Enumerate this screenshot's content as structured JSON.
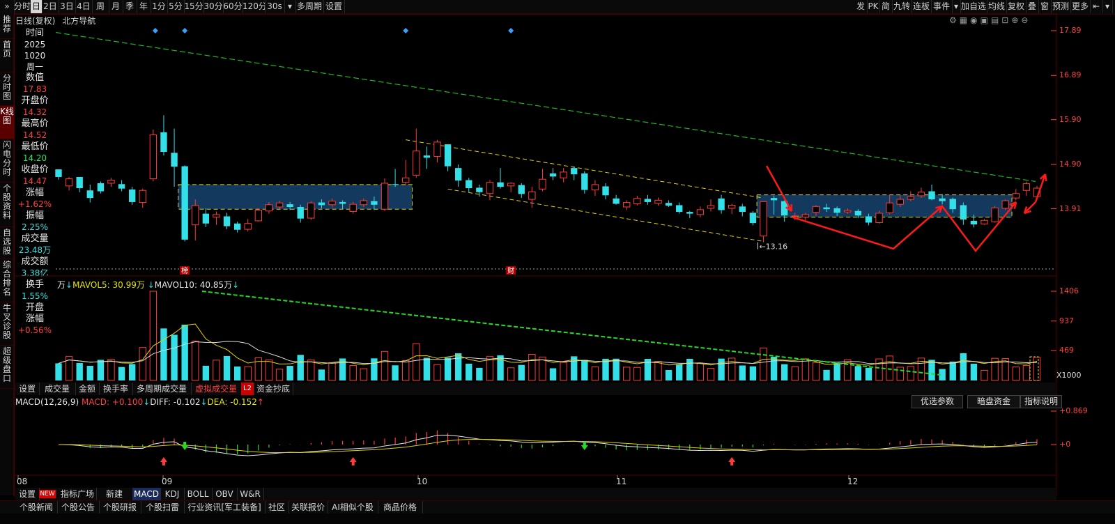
{
  "topbar": {
    "left_items": [
      "»",
      "分时",
      "日",
      "2日",
      "3日",
      "4日",
      "周",
      "月",
      "季",
      "年",
      "1分",
      "5分",
      "15分",
      "30分",
      "60分",
      "120分",
      "30s",
      "▾",
      "多周期",
      "设置"
    ],
    "right_items": [
      "发",
      "PK",
      "简",
      "九转",
      "连板",
      "事件",
      "▾",
      "加自选",
      "均线",
      "复权",
      "叠",
      "窗",
      "预测",
      "更多",
      "⇤",
      "▾"
    ]
  },
  "leftnav": [
    "推荐",
    "首页",
    "分时图",
    "K线图",
    "闪电分时",
    "个股资料",
    "自选股",
    "综合排名",
    "牛叉诊股",
    "超级盘口"
  ],
  "chart_header": {
    "title": "日线(复权)",
    "stock": "北方导航"
  },
  "info_panel": [
    {
      "label": "时间",
      "value_lines": [
        "2025",
        "1020",
        "周一"
      ],
      "color": "lbl"
    },
    {
      "label": "数值",
      "value": "17.83",
      "color": "red"
    },
    {
      "label": "开盘价",
      "value": "14.32",
      "color": "red"
    },
    {
      "label": "最高价",
      "value": "14.52",
      "color": "red"
    },
    {
      "label": "最低价",
      "value": "14.20",
      "color": "grn"
    },
    {
      "label": "收盘价",
      "value": "14.47",
      "color": "red"
    },
    {
      "label": "涨幅",
      "value": "+1.62%",
      "color": "red"
    },
    {
      "label": "振幅",
      "value": "2.25%",
      "color": "cyan"
    },
    {
      "label": "成交量",
      "value": "23.48万",
      "color": "cyan"
    },
    {
      "label": "成交额",
      "value": "3.38亿",
      "color": "cyan"
    },
    {
      "label": "换手",
      "value": "1.55%",
      "color": "cyan"
    },
    {
      "label": "开盘涨幅",
      "value": "+0.56%",
      "color": "red"
    }
  ],
  "price_axis": [
    "17.89",
    "16.89",
    "15.90",
    "14.90",
    "13.91"
  ],
  "low_mark": "13.16",
  "event_marks": [
    "榜",
    "财"
  ],
  "volume_header": {
    "unit": "万",
    "mavol5": "MAVOL5: 30.99万",
    "mavol10": "MAVOL10: 40.85万"
  },
  "volume_axis": [
    "1406",
    "937",
    "469",
    "X1000"
  ],
  "volume_tabs": [
    "设置",
    "成交量",
    "金额",
    "换手率",
    "多周期成交量",
    "虚拟成交量",
    "L2",
    "资金抄底"
  ],
  "macd_header": {
    "name": "MACD(12,26,9)",
    "macd": "MACD: +0.100",
    "diff": "DIFF: -0.102",
    "dea": "DEA: -0.152"
  },
  "macd_buttons": [
    "优选参数",
    "暗盘资金",
    "指标说明"
  ],
  "macd_axis": [
    "+0.869",
    "+0"
  ],
  "months": [
    "08",
    "09",
    "10",
    "11",
    "12"
  ],
  "indicator_tabs": [
    "设置",
    "NEW",
    "指标广场",
    "新建",
    "MACD",
    "KDJ",
    "BOLL",
    "OBV",
    "W&R"
  ],
  "bottom_tabs": [
    "个股新闻",
    "个股公告",
    "个股研报",
    "个股扫雷",
    "行业资讯[军工装备]",
    "社区",
    "关联报价",
    "AI相似个股",
    "商品价格"
  ],
  "colors": {
    "up": "#ff3b3b",
    "down": "#33e0e8",
    "box": "#133a5e",
    "trend_green": "#1fb81f",
    "trend_yellow": "#e6d200",
    "arrow": "#ff1a1a"
  },
  "chart_data": {
    "type": "candlestick",
    "price_range": [
      13.0,
      17.89
    ],
    "candles": [
      [
        14.79,
        14.62,
        14.79,
        14.56
      ],
      [
        14.42,
        14.58,
        14.62,
        14.32
      ],
      [
        14.62,
        14.37,
        14.62,
        14.28
      ],
      [
        14.32,
        14.15,
        14.45,
        14.05
      ],
      [
        14.48,
        14.3,
        14.52,
        14.25
      ],
      [
        14.48,
        14.55,
        14.6,
        14.4
      ],
      [
        14.46,
        14.36,
        14.55,
        14.3
      ],
      [
        14.34,
        14.06,
        14.4,
        14.0
      ],
      [
        14.05,
        14.32,
        14.36,
        13.93
      ],
      [
        14.58,
        15.56,
        15.68,
        14.52
      ],
      [
        15.62,
        15.18,
        16.0,
        15.1
      ],
      [
        15.16,
        14.85,
        15.7,
        14.4
      ],
      [
        14.86,
        13.22,
        14.88,
        13.18
      ],
      [
        13.55,
        13.98,
        14.12,
        13.2
      ],
      [
        13.8,
        13.58,
        13.92,
        13.5
      ],
      [
        13.72,
        13.78,
        13.85,
        13.55
      ],
      [
        13.74,
        13.52,
        13.82,
        13.45
      ],
      [
        13.58,
        13.44,
        13.62,
        13.38
      ],
      [
        13.45,
        13.58,
        13.68,
        13.4
      ],
      [
        13.64,
        13.88,
        13.92,
        13.62
      ],
      [
        13.86,
        14.0,
        14.06,
        13.8
      ],
      [
        13.95,
        14.04,
        14.09,
        13.9
      ],
      [
        14.01,
        13.95,
        14.06,
        13.88
      ],
      [
        13.95,
        13.69,
        14.0,
        13.6
      ],
      [
        13.7,
        14.04,
        14.08,
        13.66
      ],
      [
        14.05,
        13.99,
        14.12,
        13.92
      ],
      [
        14.0,
        14.08,
        14.14,
        13.94
      ],
      [
        14.06,
        14.02,
        14.1,
        13.9
      ],
      [
        13.85,
        14.01,
        14.06,
        13.8
      ],
      [
        14.0,
        14.09,
        14.14,
        13.95
      ],
      [
        14.08,
        14.0,
        14.18,
        13.88
      ],
      [
        13.9,
        14.48,
        14.59,
        13.86
      ],
      [
        14.46,
        14.45,
        14.8,
        14.4
      ],
      [
        14.5,
        14.6,
        15.0,
        14.45
      ],
      [
        14.66,
        15.2,
        15.7,
        14.6
      ],
      [
        15.1,
        15.05,
        15.3,
        14.8
      ],
      [
        15.08,
        15.4,
        15.45,
        14.95
      ],
      [
        15.35,
        14.86,
        15.3,
        14.75
      ],
      [
        14.82,
        14.54,
        14.9,
        14.4
      ],
      [
        14.55,
        14.37,
        14.6,
        14.28
      ],
      [
        14.38,
        14.28,
        14.45,
        14.18
      ],
      [
        14.25,
        14.5,
        14.55,
        14.1
      ],
      [
        14.5,
        14.4,
        14.82,
        14.36
      ],
      [
        14.42,
        14.48,
        14.5,
        14.28
      ],
      [
        14.44,
        14.24,
        14.48,
        14.15
      ],
      [
        14.12,
        14.29,
        14.4,
        13.93
      ],
      [
        14.35,
        14.57,
        14.8,
        14.3
      ],
      [
        14.7,
        14.63,
        14.82,
        14.55
      ],
      [
        14.6,
        14.73,
        14.82,
        14.5
      ],
      [
        14.82,
        14.68,
        14.86,
        14.55
      ],
      [
        14.7,
        14.33,
        14.75,
        14.25
      ],
      [
        14.33,
        14.45,
        14.55,
        14.2
      ],
      [
        14.41,
        14.21,
        14.48,
        14.12
      ],
      [
        14.14,
        14.02,
        14.22,
        14.0
      ],
      [
        13.95,
        14.05,
        14.1,
        13.88
      ],
      [
        14.02,
        14.14,
        14.2,
        13.98
      ],
      [
        14.13,
        14.06,
        14.22,
        14.0
      ],
      [
        14.03,
        14.1,
        14.16,
        13.98
      ],
      [
        14.04,
        13.98,
        14.1,
        13.95
      ],
      [
        13.99,
        13.84,
        14.05,
        13.8
      ],
      [
        13.84,
        13.8,
        13.86,
        13.7
      ],
      [
        13.78,
        13.89,
        13.96,
        13.72
      ],
      [
        13.92,
        13.98,
        14.12,
        13.85
      ],
      [
        14.14,
        13.88,
        14.22,
        13.8
      ],
      [
        13.92,
        13.99,
        14.02,
        13.79
      ],
      [
        13.96,
        13.84,
        14.02,
        13.74
      ],
      [
        13.82,
        13.59,
        13.86,
        13.54
      ],
      [
        13.3,
        14.07,
        14.07,
        13.16
      ],
      [
        14.15,
        14.1,
        14.2,
        13.78
      ],
      [
        14.08,
        13.76,
        14.1,
        13.62
      ],
      [
        13.74,
        13.75,
        13.82,
        13.66
      ],
      [
        13.72,
        13.78,
        13.82,
        13.65
      ],
      [
        13.83,
        13.96,
        13.99,
        13.75
      ],
      [
        13.94,
        13.9,
        14.02,
        13.84
      ],
      [
        13.92,
        13.82,
        13.96,
        13.75
      ],
      [
        13.84,
        13.87,
        13.92,
        13.8
      ],
      [
        13.86,
        13.76,
        13.9,
        13.7
      ],
      [
        13.74,
        13.6,
        13.8,
        13.54
      ],
      [
        13.6,
        13.81,
        13.87,
        13.58
      ],
      [
        13.82,
        14.04,
        14.22,
        13.79
      ],
      [
        14.01,
        14.12,
        14.22,
        13.95
      ],
      [
        14.12,
        14.18,
        14.3,
        14.08
      ],
      [
        14.2,
        14.28,
        14.38,
        14.15
      ],
      [
        14.3,
        14.12,
        14.45,
        14.1
      ],
      [
        14.14,
        14.08,
        14.24,
        14.01
      ],
      [
        14.13,
        13.9,
        14.16,
        13.82
      ],
      [
        13.99,
        13.67,
        14.05,
        13.55
      ],
      [
        13.64,
        13.56,
        13.78,
        13.49
      ],
      [
        13.57,
        13.65,
        13.68,
        13.55
      ],
      [
        13.62,
        13.93,
        13.97,
        13.6
      ],
      [
        13.92,
        14.09,
        14.12,
        13.88
      ],
      [
        14.15,
        14.25,
        14.35,
        14.1
      ],
      [
        14.32,
        14.47,
        14.52,
        14.2
      ],
      [
        14.18,
        14.37,
        14.42,
        14.12
      ]
    ],
    "volume_unit": "万",
    "macd_series": [
      "DIFF",
      "DEA",
      "MACD"
    ]
  }
}
